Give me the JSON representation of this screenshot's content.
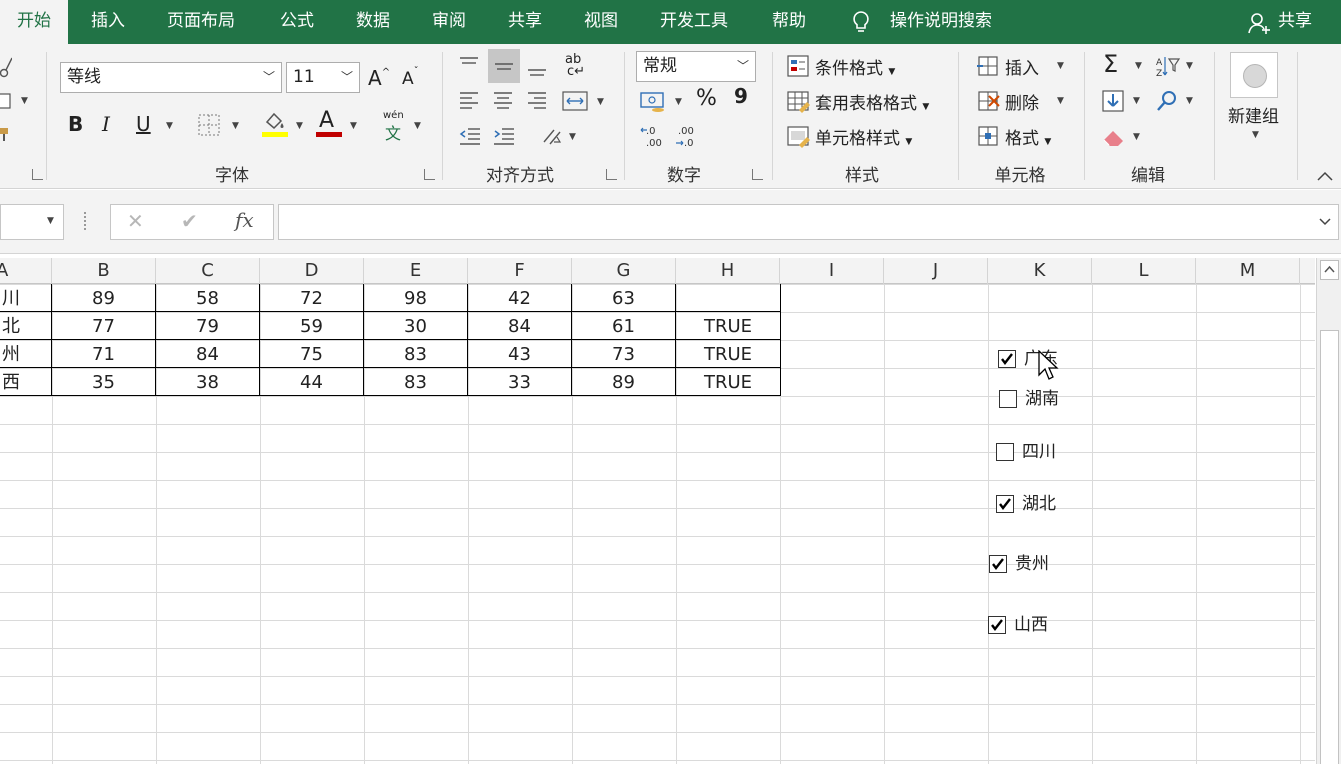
{
  "colors": {
    "accent": "#217346",
    "ribbon_bg": "#f3f3f3"
  },
  "menu": {
    "tabs": [
      "开始",
      "插入",
      "页面布局",
      "公式",
      "数据",
      "审阅",
      "共享",
      "视图",
      "开发工具",
      "帮助"
    ],
    "tell_me": "操作说明搜索",
    "share": "共享"
  },
  "ribbon": {
    "font": {
      "name": "等线",
      "size": "11",
      "label": "字体",
      "bold": "B",
      "italic": "I",
      "underline": "U",
      "font_color_glyph": "A",
      "grow_glyph": "A",
      "shrink_glyph": "A"
    },
    "phonetic_glyph": "wén",
    "phonetic_char": "文",
    "alignment": {
      "label": "对齐方式",
      "wrap_glyph": "ab"
    },
    "number": {
      "format": "常规",
      "label": "数字",
      "percent": "%",
      "comma": "9"
    },
    "styles": {
      "label": "样式",
      "conditional": "条件格式",
      "table_format": "套用表格格式",
      "cell_style": "单元格样式"
    },
    "cells": {
      "label": "单元格",
      "insert": "插入",
      "delete": "删除",
      "format": "格式"
    },
    "editing": {
      "label": "编辑",
      "sigma": "Σ"
    },
    "new_group": "新建组"
  },
  "formula_bar": {
    "fx": "fx",
    "cancel": "✕",
    "enter": "✔",
    "value": ""
  },
  "columns": [
    "A",
    "B",
    "C",
    "D",
    "E",
    "F",
    "G",
    "H",
    "I",
    "J",
    "K",
    "L",
    "M"
  ],
  "rows": [
    [
      "川",
      "89",
      "58",
      "72",
      "98",
      "42",
      "63",
      ""
    ],
    [
      "北",
      "77",
      "79",
      "59",
      "30",
      "84",
      "61",
      "TRUE"
    ],
    [
      "州",
      "71",
      "84",
      "75",
      "83",
      "43",
      "73",
      "TRUE"
    ],
    [
      "西",
      "35",
      "38",
      "44",
      "83",
      "33",
      "89",
      "TRUE"
    ]
  ],
  "checkboxes": [
    {
      "label": "广东",
      "checked": true
    },
    {
      "label": "湖南",
      "checked": false
    },
    {
      "label": "四川",
      "checked": false
    },
    {
      "label": "湖北",
      "checked": true
    },
    {
      "label": "贵州",
      "checked": true
    },
    {
      "label": "山西",
      "checked": true
    }
  ]
}
